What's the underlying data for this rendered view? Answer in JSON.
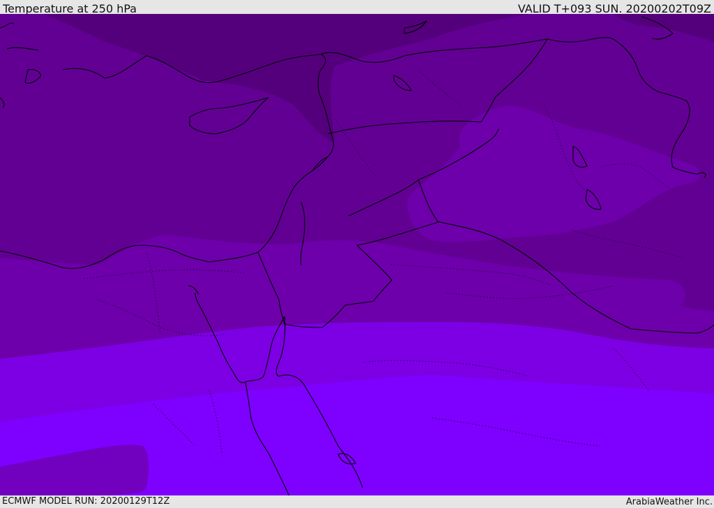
{
  "header": {
    "title": "Temperature at 250 hPa",
    "valid_time": "VALID T+093 SUN. 20200202T09Z"
  },
  "footer": {
    "model_run": "ECMWF MODEL RUN: 20200129T12Z",
    "credit": "ArabiaWeather Inc."
  },
  "map": {
    "field": "temperature",
    "level": "250 hPa",
    "palette": {
      "band_coldest": "#54007c",
      "band_2": "#620094",
      "band_3": "#6d00ab",
      "band_4": "#7100bf",
      "band_5": "#7d00e4",
      "band_warmest": "#7e00ff",
      "coastline": "#000000",
      "country_border": "#000000",
      "admin_border": "#2a004a"
    }
  }
}
